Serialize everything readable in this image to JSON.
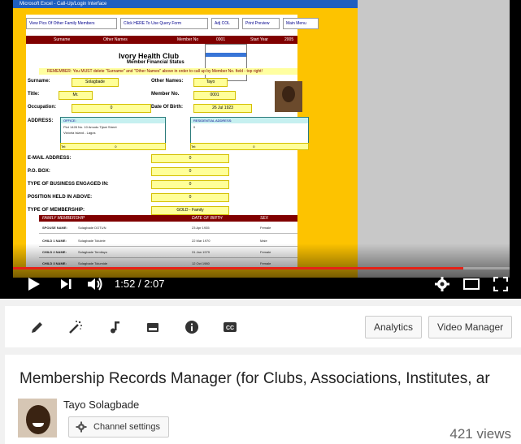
{
  "player": {
    "time_current": "1:52",
    "time_separator": "/",
    "time_total": "2:07",
    "progress_fraction": 0.906,
    "excel": {
      "window_title": "Microsoft Excel - Call-Up/Login Interface",
      "buttons": [
        "View Pics Of Other Family Members",
        "Click HERE To Use Query Form",
        "Adj COL",
        "Print Preview",
        "Main Menu"
      ],
      "header_row": {
        "surname": "Surname",
        "other_names": "Other Names",
        "member_no": "Member No",
        "member_no_value": "0001",
        "start_year": "Start Year",
        "start_year_value": "2005"
      },
      "club_name": "Ivory Health Club",
      "club_subtitle": "Member Financial Status",
      "remember": "REMEMBER: You MUST delete \"Surname\" and \"Other Names\" above in order to call up by Member No. field - top right!",
      "fields": {
        "surname_label": "Surname:",
        "surname_value": "Solagbade",
        "other_names_label": "Other Names:",
        "other_names_value": "Tayo",
        "title_label": "Title:",
        "title_value": "Mr.",
        "member_no_label": "Member No.",
        "member_no_value": "0001",
        "occupation_label": "Occupation:",
        "occupation_value": "0",
        "dob_label": "Date Of Birth:",
        "dob_value": "26 Jul 1923",
        "address_label": "ADDRESS:",
        "office_label": "OFFICE:",
        "office_line1": "Plot 1428 No. 10 Amodu Tijani Street",
        "office_line2": "Victoria Island - Lagos",
        "residential_label": "RESIDENTIAL ADDRESS:",
        "residential_value": "0",
        "tel_label": "Tel:",
        "tel_value": "0",
        "email_label": "E-MAIL ADDRESS:",
        "email_value": "0",
        "pobox_label": "P.O. BOX:",
        "pobox_value": "0",
        "business_label": "TYPE OF BUSINESS ENGAGED IN:",
        "business_value": "0",
        "position_label": "POSITION HELD IN ABOVE:",
        "position_value": "0",
        "membership_label": "TYPE OF MEMBERSHIP:",
        "membership_value": "GOLD - Family"
      },
      "family": {
        "headers": [
          "FAMILY MEMBERSHIP",
          "DATE OF BIRTH",
          "SEX"
        ],
        "rows": [
          [
            "SPOUSE NAME:",
            "Solagbade DOTUN",
            "23 Apr 1935",
            "Female"
          ],
          [
            "CHILD 1 NAME:",
            "Solagbade Tolulele",
            "22 Mar 1970",
            "Male"
          ],
          [
            "CHILD 2 NAME:",
            "Solagbade Temilayo",
            "31 Jan 1979",
            "Female"
          ],
          [
            "CHILD 3 NAME:",
            "Solagbade Tolumide",
            "12 Oct 1980",
            "Female"
          ]
        ]
      }
    }
  },
  "toolbar": {
    "icons": [
      "pencil-icon",
      "magic-wand-icon",
      "music-note-icon",
      "card-icon",
      "info-icon",
      "captions-icon"
    ],
    "analytics_label": "Analytics",
    "video_manager_label": "Video Manager"
  },
  "info": {
    "title": "Membership Records Manager (for Clubs, Associations, Institutes, ar",
    "channel_name": "Tayo Solagbade",
    "channel_settings_label": "Channel settings",
    "views": "421 views"
  },
  "colors": {
    "progress_red": "#e62117",
    "excel_orange": "#fdc300",
    "excel_maroon": "#800000"
  }
}
